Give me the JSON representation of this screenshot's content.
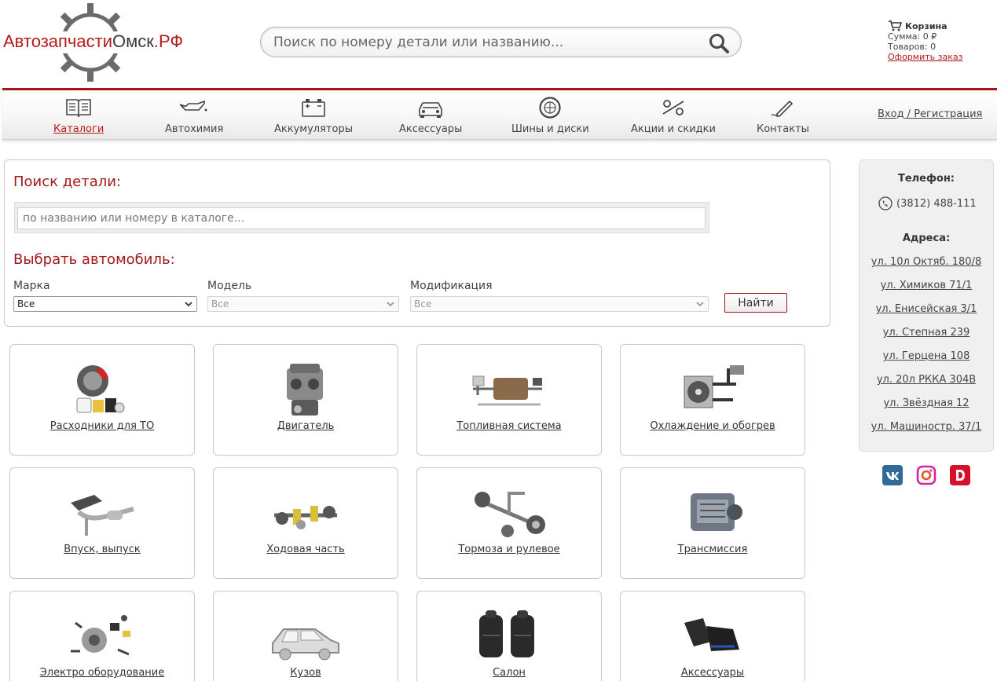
{
  "logo": {
    "text_red": "Автозапчасти",
    "text_dark": "Омск",
    "text_tail": ".РФ"
  },
  "header_search": {
    "placeholder": "Поиск по номеру детали или названию..."
  },
  "cart": {
    "title": "Корзина",
    "sum": "Сумма: 0 ₽",
    "items": "Товаров: 0",
    "checkout": "Оформить заказ"
  },
  "nav": {
    "items": [
      {
        "label": "Каталоги",
        "icon": "catalog-book-icon",
        "active": true
      },
      {
        "label": "Автохимия",
        "icon": "oil-can-icon"
      },
      {
        "label": "Аккумуляторы",
        "icon": "battery-icon"
      },
      {
        "label": "Аксессуары",
        "icon": "car-front-icon"
      },
      {
        "label": "Шины и диски",
        "icon": "tire-icon"
      },
      {
        "label": "Акции и скидки",
        "icon": "percent-icon"
      },
      {
        "label": "Контакты",
        "icon": "pen-icon"
      }
    ],
    "login": "Вход / Регистрация"
  },
  "part_search": {
    "heading": "Поиск детали:",
    "placeholder": "по названию или номеру в каталоге..."
  },
  "car_select": {
    "heading": "Выбрать автомобиль:",
    "brand_label": "Марка",
    "brand_value": "Все",
    "model_label": "Модель",
    "model_value": "Все",
    "mod_label": "Модификация",
    "mod_value": "Все",
    "find_button": "Найти"
  },
  "categories": [
    {
      "label": "Расходники для ТО",
      "icon": "maintenance-parts-icon"
    },
    {
      "label": "Двигатель",
      "icon": "engine-icon"
    },
    {
      "label": "Топливная система",
      "icon": "fuel-system-icon"
    },
    {
      "label": "Охлаждение и обогрев",
      "icon": "cooling-icon"
    },
    {
      "label": "Впуск, выпуск",
      "icon": "exhaust-icon"
    },
    {
      "label": "Ходовая часть",
      "icon": "suspension-icon"
    },
    {
      "label": "Тормоза и рулевое",
      "icon": "steering-icon"
    },
    {
      "label": "Трансмиссия",
      "icon": "transmission-icon"
    },
    {
      "label": "Электро оборудование",
      "icon": "electrical-icon"
    },
    {
      "label": "Кузов",
      "icon": "car-body-icon"
    },
    {
      "label": "Салон",
      "icon": "car-seat-icon"
    },
    {
      "label": "Аксессуары",
      "icon": "floor-mats-icon"
    }
  ],
  "sidebar": {
    "phone_title": "Телефон:",
    "phone": "(3812) 488-111",
    "address_title": "Адреса:",
    "addresses": [
      "ул. 10л Октяб. 180/8",
      "ул. Химиков 71/1",
      "ул. Енисейская 3/1",
      "ул. Степная 239",
      "ул. Герцена 108",
      "ул. 20л РККА 304В",
      "ул. Звёздная 12",
      "ул. Машиностр. 37/1"
    ]
  },
  "social": [
    {
      "name": "vk-icon",
      "color": "#2f6a9a"
    },
    {
      "name": "instagram-icon",
      "color": "#d6249f"
    },
    {
      "name": "drive2-icon",
      "color": "#d8102a"
    }
  ],
  "colors": {
    "accent": "#b51a1a",
    "nav_red_line": "#a81515"
  }
}
